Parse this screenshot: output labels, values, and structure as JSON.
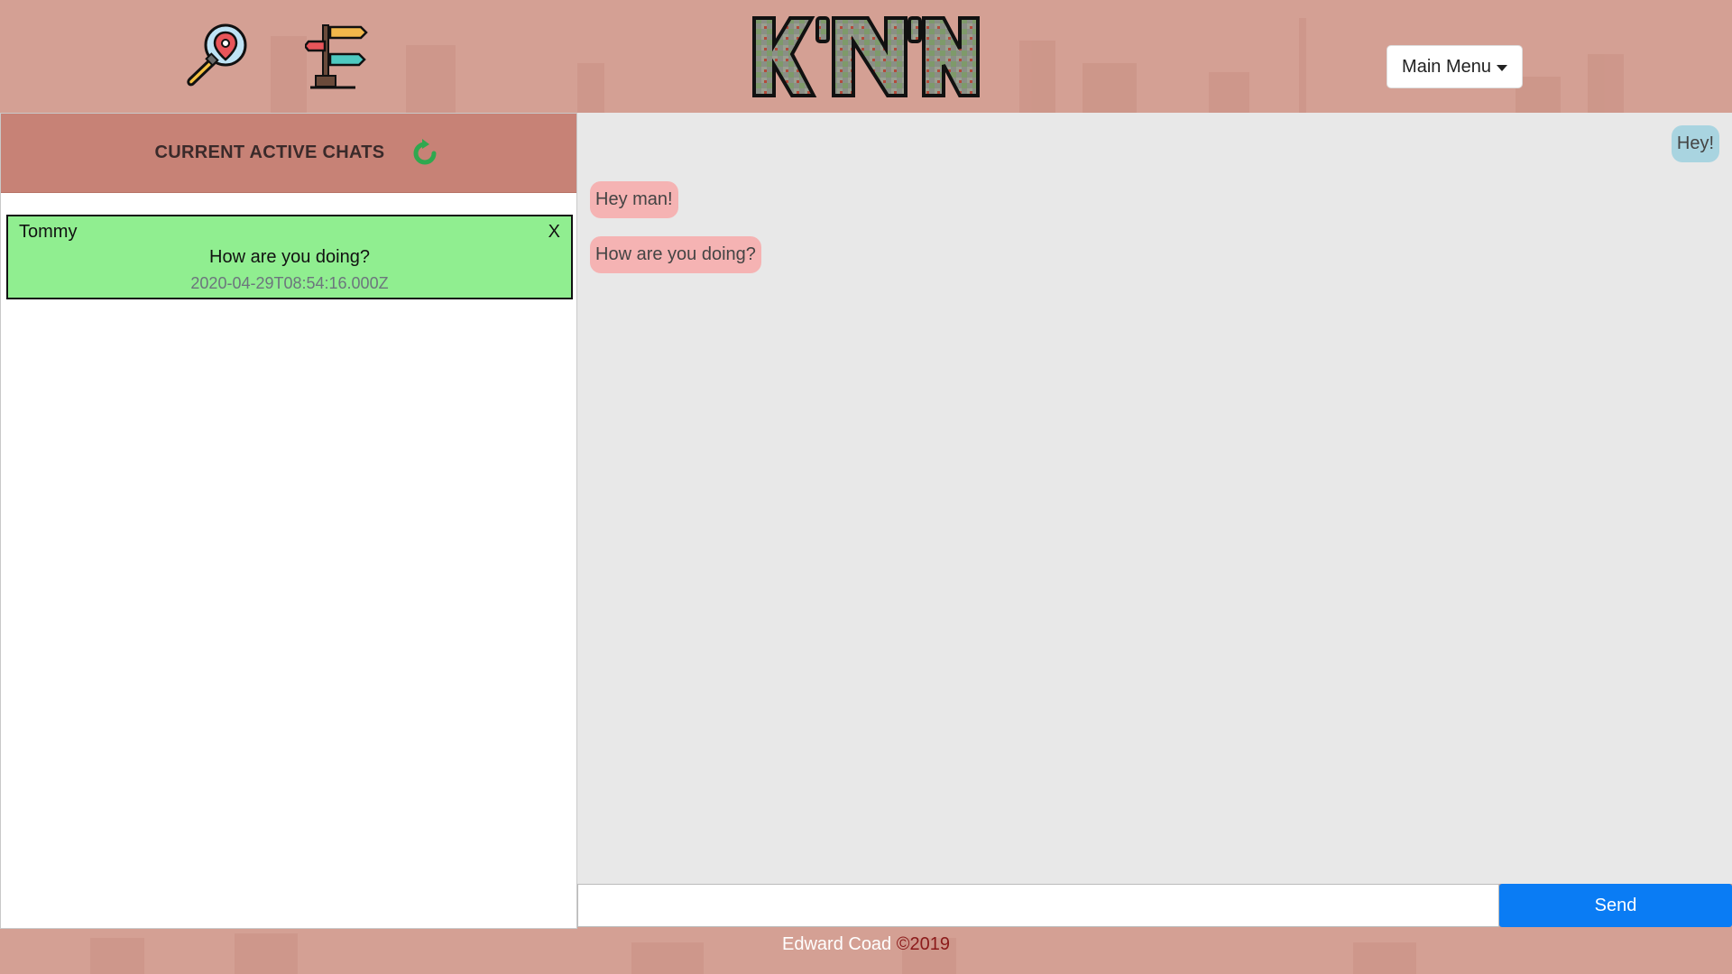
{
  "header": {
    "menu_label": "Main Menu",
    "logo_text": "K'N'N",
    "icons": [
      "map-search-icon",
      "signpost-icon"
    ]
  },
  "chats": {
    "title": "CURRENT ACTIVE CHATS",
    "items": [
      {
        "name": "Tommy",
        "close": "X",
        "preview": "How are you doing?",
        "timestamp": "2020-04-29T08:54:16.000Z"
      }
    ]
  },
  "messages": [
    {
      "direction": "sent",
      "text": "Hey!"
    },
    {
      "direction": "received",
      "text": "Hey man!"
    },
    {
      "direction": "received",
      "text": "How are you doing?"
    }
  ],
  "composer": {
    "value": "",
    "send_label": "Send"
  },
  "footer": {
    "author": "Edward Coad",
    "copyright": "©2019"
  },
  "colors": {
    "page_bg": "#d4a094",
    "chats_header": "#c78276",
    "active_chat": "#90ee90",
    "sent_bubble": "#a9d4e0",
    "received_bubble": "#f5b3b3",
    "send_button": "#0a7cf4"
  }
}
